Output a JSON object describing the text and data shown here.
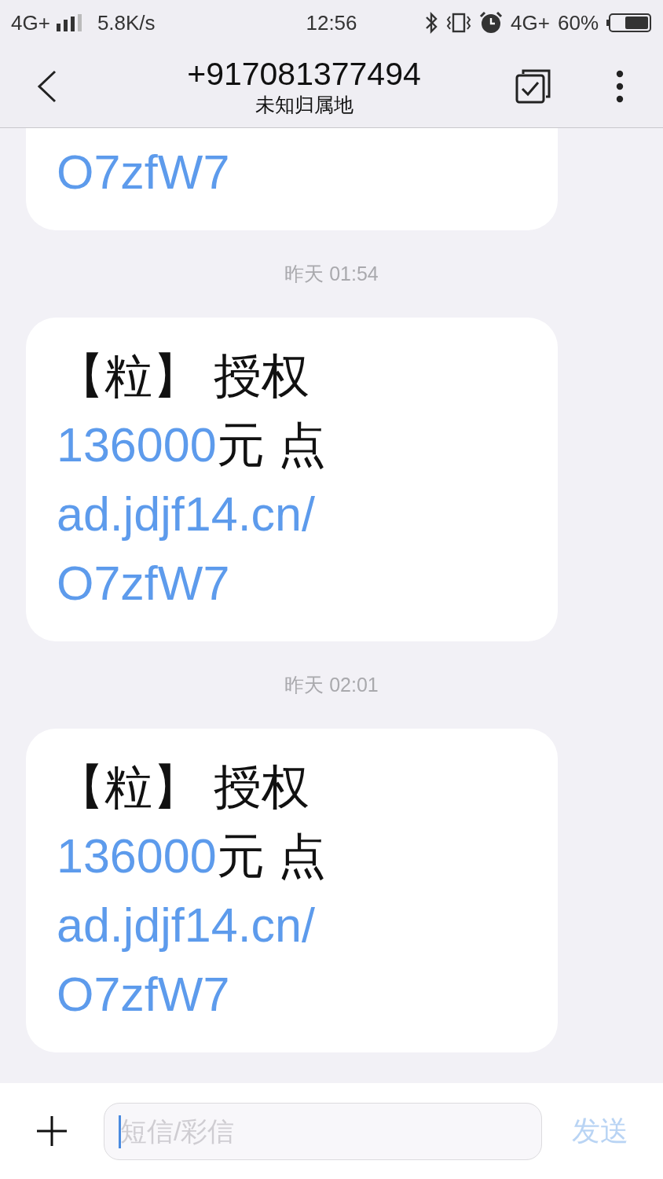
{
  "status_bar": {
    "network": "4G+",
    "speed": "5.8K/s",
    "time": "12:56",
    "data_network": "4G+",
    "battery": "60%"
  },
  "header": {
    "title": "+917081377494",
    "subtitle": "未知归属地"
  },
  "thread": [
    {
      "kind": "message",
      "lines": [
        [
          {
            "kind": "link",
            "text": "O7zfW7"
          }
        ]
      ]
    },
    {
      "kind": "timestamp",
      "text": "昨天 01:54"
    },
    {
      "kind": "message",
      "lines": [
        [
          {
            "kind": "plain",
            "text": "【粒】 授权"
          }
        ],
        [
          {
            "kind": "link",
            "text": "136000"
          },
          {
            "kind": "plain",
            "text": "元 点"
          }
        ],
        [
          {
            "kind": "link",
            "text": "ad.jdjf14.cn/"
          }
        ],
        [
          {
            "kind": "link",
            "text": "O7zfW7"
          }
        ]
      ]
    },
    {
      "kind": "timestamp",
      "text": "昨天 02:01"
    },
    {
      "kind": "message",
      "lines": [
        [
          {
            "kind": "plain",
            "text": "【粒】 授权"
          }
        ],
        [
          {
            "kind": "link",
            "text": "136000"
          },
          {
            "kind": "plain",
            "text": "元 点"
          }
        ],
        [
          {
            "kind": "link",
            "text": "ad.jdjf14.cn/"
          }
        ],
        [
          {
            "kind": "link",
            "text": "O7zfW7"
          }
        ]
      ]
    }
  ],
  "compose": {
    "placeholder": "短信/彩信",
    "send_label": "发送"
  }
}
